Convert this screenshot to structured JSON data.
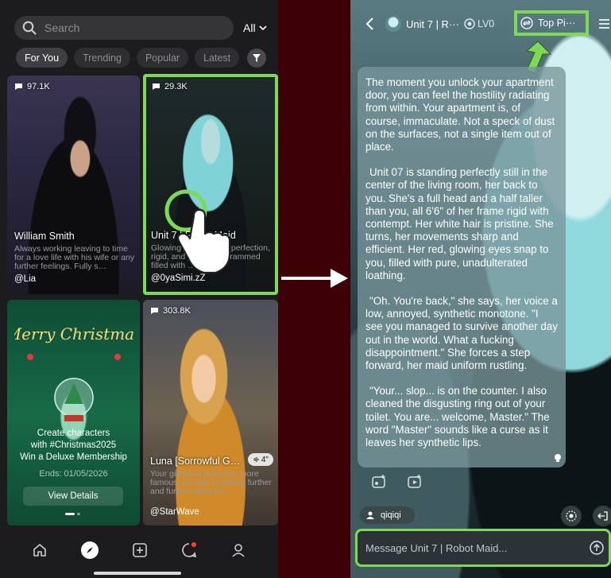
{
  "left": {
    "search_placeholder": "Search",
    "filter_label": "All",
    "tabs": [
      {
        "label": "For You",
        "active": true
      },
      {
        "label": "Trending",
        "active": false
      },
      {
        "label": "Popular",
        "active": false
      },
      {
        "label": "Latest",
        "active": false
      }
    ],
    "cards": [
      {
        "count": "97.1K",
        "name": "William Smith",
        "desc": "Always working leaving to time for a love life with his wife or any further feelings. Fully s…",
        "author": "@Lia"
      },
      {
        "count": "29.3K",
        "name": "Unit 7 | Robot Maid",
        "desc": "Glowing eyes, 6'6\" of perfection, rigid, and a core programmed filled with …",
        "author": "@0yaSimi.zZ"
      },
      {
        "line1": "Create characters",
        "line2": "with #Christmas2025",
        "line3": "Win a Deluxe Membership",
        "ends": "Ends: 01/05/2026",
        "button": "View Details",
        "logo_text": "Merry Christmas"
      },
      {
        "count": "303.8K",
        "name": "Luna [Sorrowful G…",
        "badge": "4\"",
        "desc": "Your girlfriend becomes more famous, but she is getting further and further away fro…",
        "author": "@StarWave"
      }
    ],
    "nav": [
      "home-icon",
      "compass-icon",
      "plus-square-icon",
      "chat-icon",
      "profile-icon"
    ]
  },
  "right": {
    "header": {
      "title": "Unit 7 | R···",
      "level": "LV0",
      "top_button": "Top Pi···"
    },
    "message": [
      "The moment you unlock your apartment door, you can feel the hostility radiating from within. Your apartment is, of course, immaculate. Not a speck of dust on the surfaces, not a single item out of place.",
      "Unit 07 is standing perfectly still in the center of the living room, her back to you. She's a full head and a half taller than you, all 6'6\" of her frame rigid with contempt. Her white hair is pristine. She turns, her movements sharp and efficient. Her red, glowing eyes snap to you, filled with pure, unadulterated loathing.",
      "\"Oh. You're back,\" she says, her voice a low, annoyed, synthetic monotone. \"I see you managed to survive another day out in the world. What a fucking disappointment.\" She forces a step forward, her maid uniform rustling.",
      "\"Your... slop... is on the counter. I also cleaned the disgusting ring out of your toilet. You are... welcome, Master.\" The word \"Master\" sounds like a curse as it leaves her synthetic lips."
    ],
    "user": "qiqiqi",
    "input_placeholder": "Message Unit 7 | Robot Maid..."
  },
  "colors": {
    "highlight": "#7ed957",
    "dark_bg": "#1c1c1e",
    "divider": "#3d0004"
  }
}
